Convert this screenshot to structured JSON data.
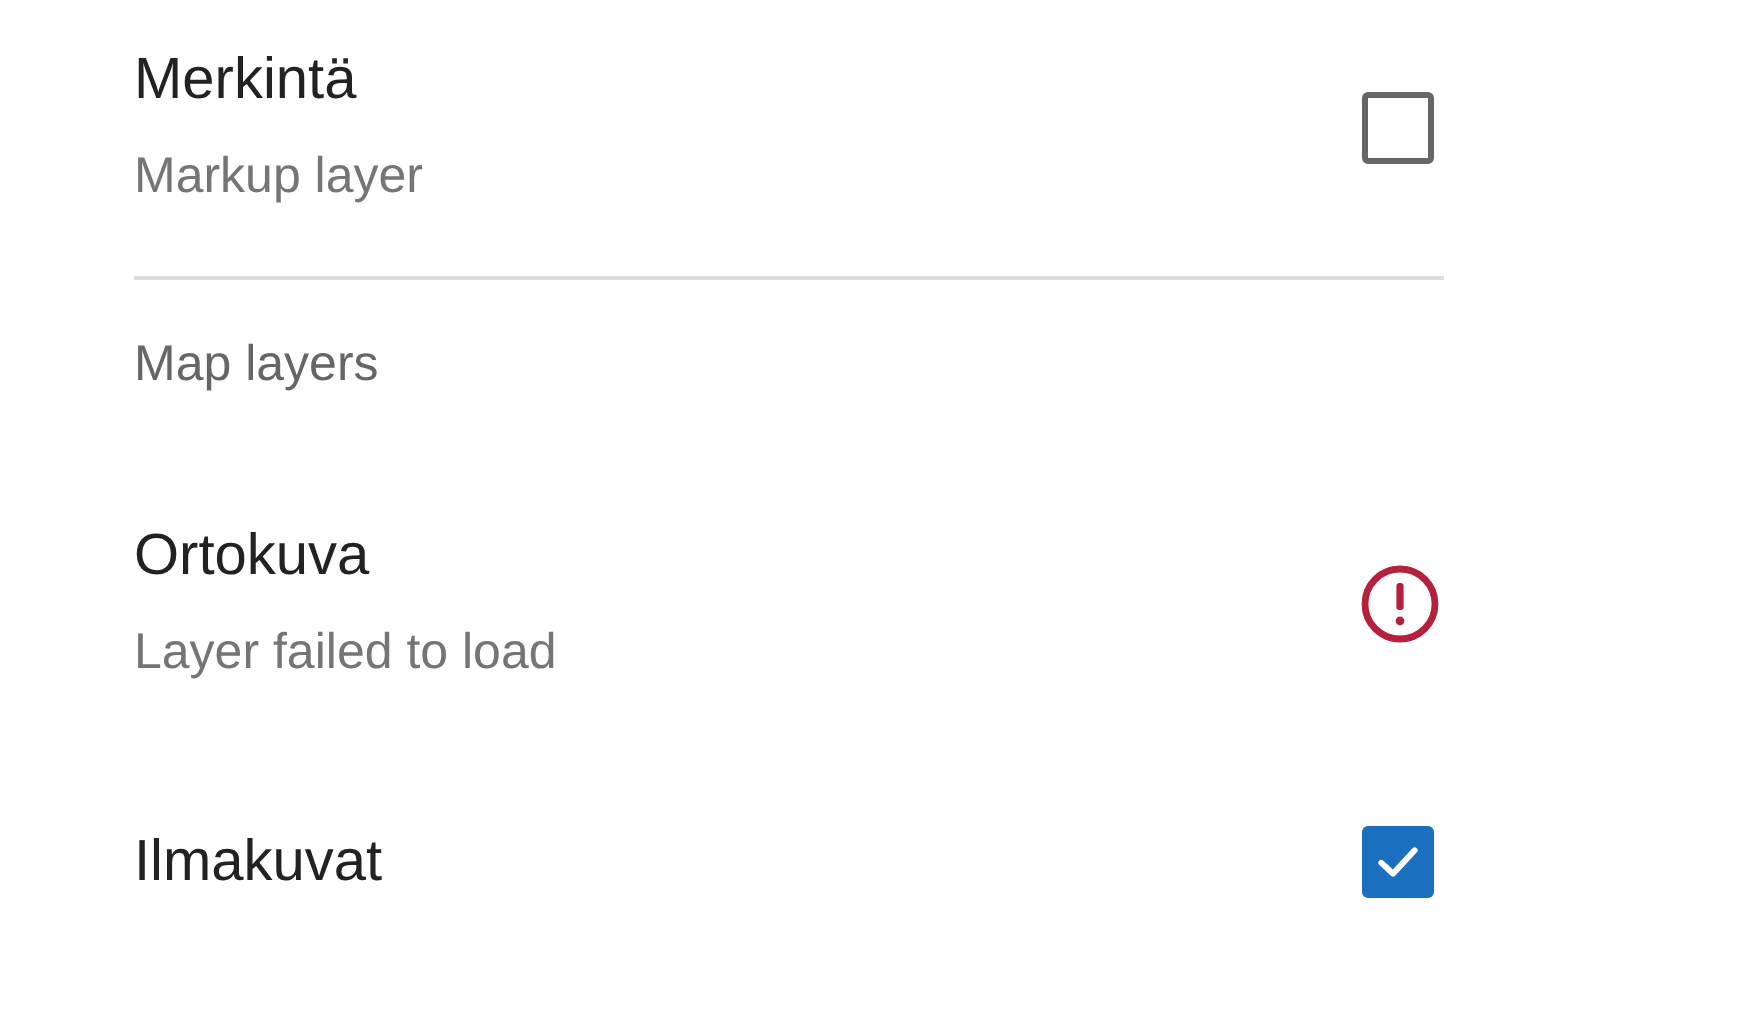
{
  "layers": [
    {
      "kind": "checkbox",
      "title": "Merkintä",
      "subtitle": "Markup layer",
      "checked": false
    }
  ],
  "section": {
    "title": "Map layers"
  },
  "map_layers": [
    {
      "kind": "error",
      "title": "Ortokuva",
      "subtitle": "Layer failed to load"
    },
    {
      "kind": "checkbox",
      "title": "Ilmakuvat",
      "checked": true
    }
  ]
}
